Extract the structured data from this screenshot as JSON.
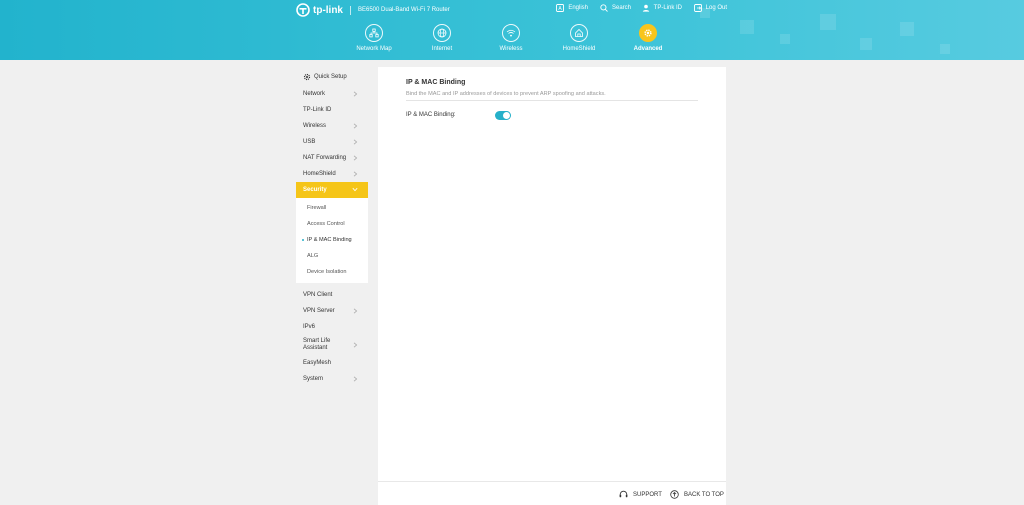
{
  "header": {
    "brand": "tp-link",
    "model": "BE6500 Dual-Band Wi-Fi 7 Router",
    "top_links": [
      {
        "label": "English",
        "icon": "language-icon"
      },
      {
        "label": "Search",
        "icon": "search-icon"
      },
      {
        "label": "TP-Link ID",
        "icon": "user-icon"
      },
      {
        "label": "Log Out",
        "icon": "logout-icon"
      }
    ],
    "main_nav": [
      {
        "label": "Network Map",
        "icon": "network-map-icon"
      },
      {
        "label": "Internet",
        "icon": "globe-icon"
      },
      {
        "label": "Wireless",
        "icon": "wifi-icon"
      },
      {
        "label": "HomeShield",
        "icon": "home-shield-icon"
      },
      {
        "label": "Advanced",
        "icon": "gear-icon",
        "active": true
      }
    ],
    "accent_color": "#f8c51c",
    "bar_color": "#3cc3d8"
  },
  "sidebar": {
    "quick_setup": "Quick Setup",
    "items": [
      {
        "label": "Network",
        "expandable": true
      },
      {
        "label": "TP-Link ID",
        "expandable": false
      },
      {
        "label": "Wireless",
        "expandable": true
      },
      {
        "label": "USB",
        "expandable": true
      },
      {
        "label": "NAT Forwarding",
        "expandable": true
      },
      {
        "label": "HomeShield",
        "expandable": true
      },
      {
        "label": "Security",
        "expandable": true,
        "active": true
      }
    ],
    "security_sub": [
      "Firewall",
      "Access Control",
      "IP & MAC Binding",
      "ALG",
      "Device Isolation"
    ],
    "items_after": [
      {
        "label": "VPN Client",
        "expandable": false
      },
      {
        "label": "VPN Server",
        "expandable": true
      },
      {
        "label": "IPv6",
        "expandable": false
      },
      {
        "label": "Smart Life Assistant",
        "expandable": true
      },
      {
        "label": "EasyMesh",
        "expandable": false
      },
      {
        "label": "System",
        "expandable": true
      }
    ]
  },
  "content": {
    "title": "IP & MAC Binding",
    "description": "Bind the MAC and IP addresses of devices to prevent ARP spoofing and attacks.",
    "field_label": "IP & MAC Binding:",
    "toggle_on": true
  },
  "footer": {
    "support": "SUPPORT",
    "back_to_top": "BACK TO TOP"
  }
}
